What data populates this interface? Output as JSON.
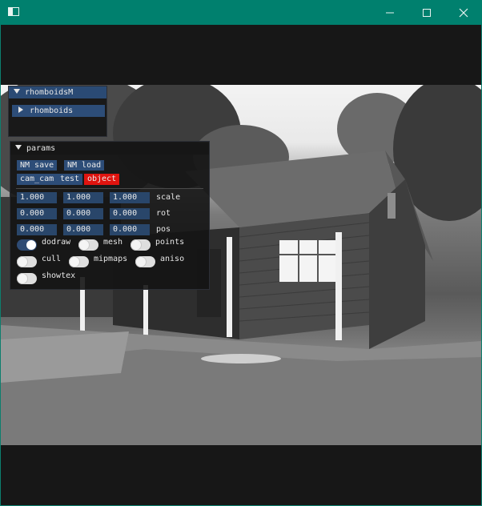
{
  "panels": {
    "rhomboidsM": {
      "title": "rhomboidsM",
      "child": "rhomboids"
    },
    "params": {
      "title": "params",
      "row1": [
        "NM save",
        "NM load"
      ],
      "row2": [
        "cam_cam",
        "test",
        "object"
      ],
      "active_tab": "object",
      "rows": [
        {
          "values": [
            "1.000",
            "1.000",
            "1.000"
          ],
          "label": "scale"
        },
        {
          "values": [
            "0.000",
            "0.000",
            "0.000"
          ],
          "label": "rot"
        },
        {
          "values": [
            "0.000",
            "0.000",
            "0.000"
          ],
          "label": "pos"
        }
      ],
      "toggles": [
        {
          "label": "dodraw",
          "on": true
        },
        {
          "label": "mesh",
          "on": false
        },
        {
          "label": "points",
          "on": false
        },
        {
          "label": "cull",
          "on": false
        },
        {
          "label": "mipmaps",
          "on": false
        },
        {
          "label": "aniso",
          "on": false
        },
        {
          "label": "showtex",
          "on": false
        }
      ]
    }
  },
  "colors": {
    "titlebar": "#00806e",
    "button": "#2d4d78",
    "active_button": "#e0140f",
    "field": "#29466a"
  },
  "icons": [
    "app-window-icon",
    "minimize-icon",
    "maximize-icon",
    "close-icon"
  ]
}
